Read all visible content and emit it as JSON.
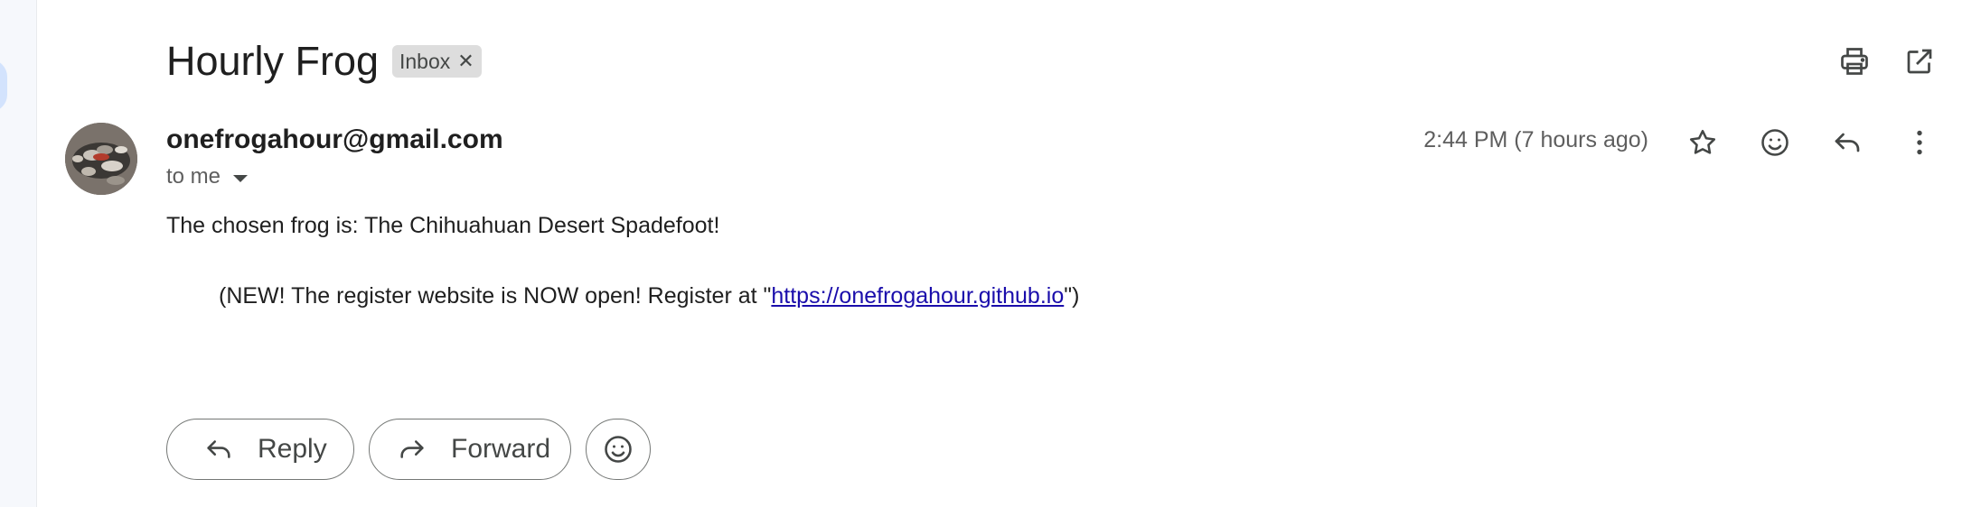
{
  "thread": {
    "subject": "Hourly Frog",
    "labels": [
      {
        "name": "Inbox",
        "remove_icon": "close-icon"
      }
    ],
    "actions": {
      "print_icon": "print-icon",
      "new_window_icon": "open-in-new-window-icon"
    }
  },
  "message": {
    "sender_email": "onefrogahour@gmail.com",
    "recipients": "to me",
    "timestamp": "2:44 PM (7 hours ago)",
    "actions": [
      "star-icon",
      "emoji-reaction-icon",
      "reply-icon",
      "more-options-icon"
    ],
    "body": {
      "line1": "The chosen frog is: The Chihuahuan Desert Spadefoot!",
      "line2_prefix": "(NEW! The register website is NOW open! Register at \"",
      "link": "https://onefrogahour.github.io",
      "line2_suffix": "\")"
    }
  },
  "footer": {
    "reply_label": "Reply",
    "forward_label": "Forward"
  },
  "colors": {
    "link": "#1a0dab",
    "chip_bg": "#dddddd",
    "text": "#1f1f1f",
    "secondary_text": "#5e5e5e"
  }
}
